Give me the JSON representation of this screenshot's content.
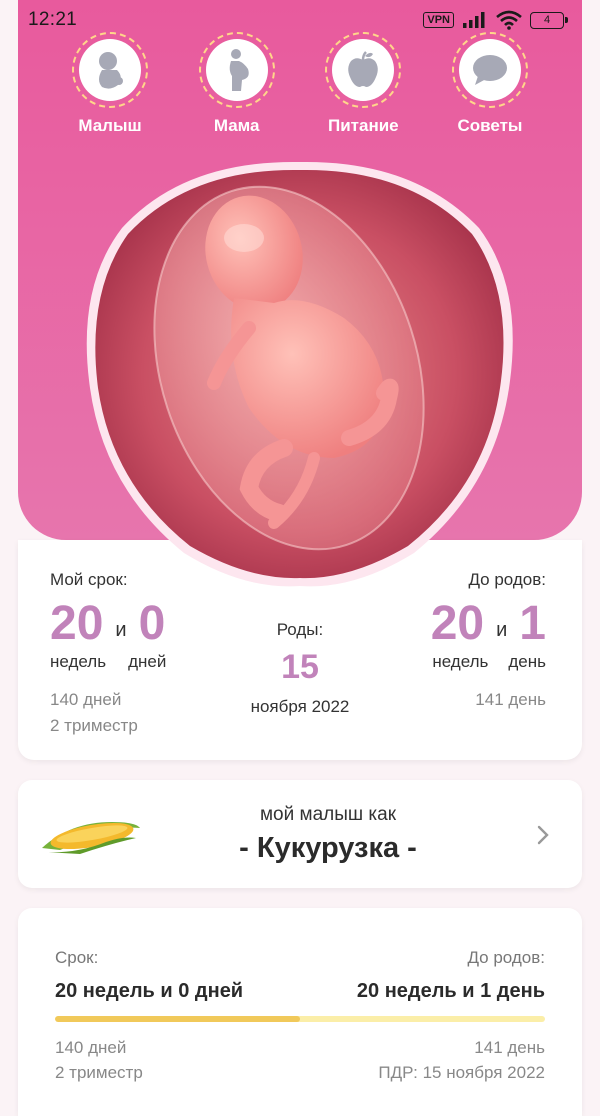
{
  "status_bar": {
    "time": "12:21",
    "vpn": "VPN",
    "battery": "4"
  },
  "nav": {
    "items": [
      {
        "label": "Малыш",
        "icon": "baby-icon"
      },
      {
        "label": "Мама",
        "icon": "pregnant-woman-icon"
      },
      {
        "label": "Питание",
        "icon": "apple-icon"
      },
      {
        "label": "Советы",
        "icon": "chat-bubble-icon"
      }
    ]
  },
  "term": {
    "label": "Мой срок:",
    "weeks": "20",
    "conj": "и",
    "days": "0",
    "weeks_unit": "недель",
    "days_unit": "дней",
    "total_days": "140 дней",
    "trimester": "2 триместр"
  },
  "birth": {
    "label": "Роды:",
    "day": "15",
    "month_year": "ноября 2022"
  },
  "remaining": {
    "label": "До родов:",
    "weeks": "20",
    "conj": "и",
    "days": "1",
    "weeks_unit": "недель",
    "days_unit": "день",
    "total_days": "141 день"
  },
  "fruit": {
    "caption": "мой малыш как",
    "name": "- Кукурузка -",
    "icon": "corn-icon"
  },
  "progress": {
    "left_label": "Срок:",
    "right_label": "До родов:",
    "left_value": "20 недель и 0 дней",
    "right_value": "20 недель и 1 день",
    "fraction": 0.5,
    "left_days": "140 дней",
    "left_trimester": "2 триместр",
    "right_days": "141 день",
    "due_date": "ПДР: 15 ноября 2022"
  },
  "colors": {
    "header_pink": "#e85a9d",
    "accent_purple": "#c183ba",
    "progress_fill": "#f1c95a",
    "progress_track": "#fbeea8"
  }
}
